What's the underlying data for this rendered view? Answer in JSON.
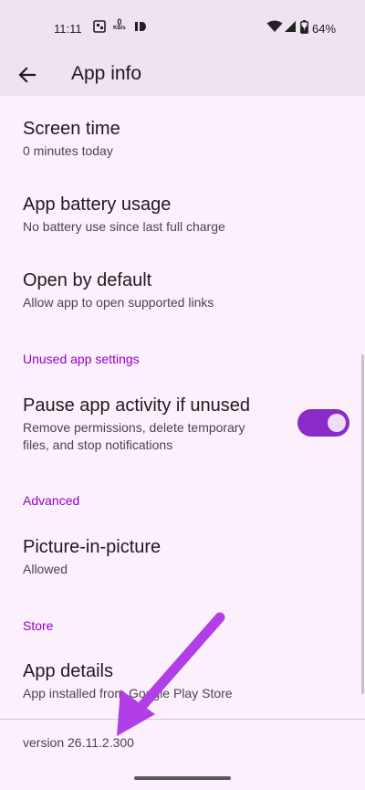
{
  "status_bar": {
    "time": "11:11",
    "net_speed_value": "0",
    "net_speed_unit": "KB/s",
    "battery_percent": "64%"
  },
  "app_bar": {
    "title": "App info",
    "back_icon": "arrow-back-icon"
  },
  "items": [
    {
      "title": "Screen time",
      "subtitle": "0 minutes today"
    },
    {
      "title": "App battery usage",
      "subtitle": "No battery use since last full charge"
    },
    {
      "title": "Open by default",
      "subtitle": "Allow app to open supported links"
    },
    {
      "title": "Pause app activity if unused",
      "subtitle": "Remove permissions, delete temporary files, and stop notifications"
    },
    {
      "title": "Picture-in-picture",
      "subtitle": "Allowed"
    },
    {
      "title": "App details",
      "subtitle": "App installed from Google Play Store"
    }
  ],
  "sections": {
    "unused": "Unused app settings",
    "advanced": "Advanced",
    "store": "Store"
  },
  "toggle_pause_app": {
    "checked": true
  },
  "version": "version 26.11.2.300",
  "colors": {
    "accent": "#9500c9",
    "toggle_track": "#8a2bc7",
    "annotation_arrow": "#b23ee8",
    "background": "#fbf0fb",
    "app_bar": "#efe2f1"
  }
}
